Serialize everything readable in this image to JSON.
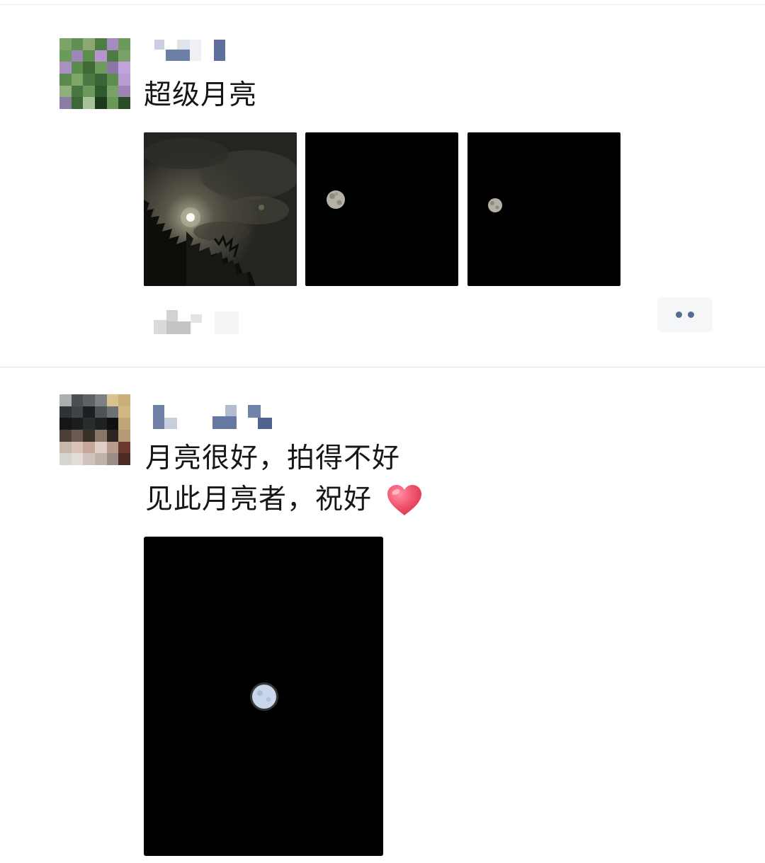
{
  "post1": {
    "text": "超级月亮",
    "photos": [
      "night-clouds-moon",
      "moon-dark-1",
      "moon-dark-2"
    ]
  },
  "post2": {
    "line1": "月亮很好，拍得不好",
    "line2": "见此月亮者，祝好",
    "emoji": "heart-icon",
    "photos": [
      "moon-dark-portrait"
    ]
  },
  "colors": {
    "name_blue": "#576b95",
    "more_dot": "#576b95",
    "more_bg": "#f5f6f8",
    "heart": "#ee4f6e"
  }
}
